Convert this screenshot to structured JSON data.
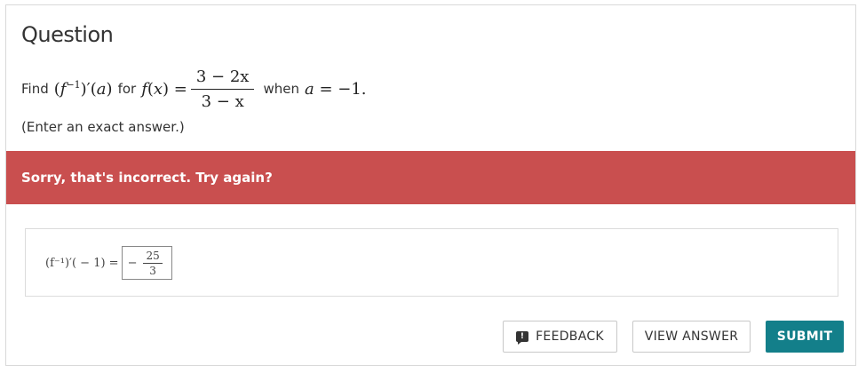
{
  "question": {
    "title": "Question",
    "find_label": "Find",
    "for_label": "for",
    "when_label": "when",
    "function_numerator": "3 − 2x",
    "function_denominator": "3 − x",
    "a_value": "−1",
    "instruction": "(Enter an exact answer.)"
  },
  "banner": {
    "message": "Sorry, that's incorrect. Try again?"
  },
  "answer": {
    "expression": "(f⁻¹)′( − 1) =",
    "sign": "−",
    "numerator": "25",
    "denominator": "3"
  },
  "buttons": {
    "feedback": "FEEDBACK",
    "view_answer": "VIEW ANSWER",
    "submit": "SUBMIT"
  },
  "colors": {
    "error_banner": "#c94f4f",
    "submit": "#137f8a"
  }
}
